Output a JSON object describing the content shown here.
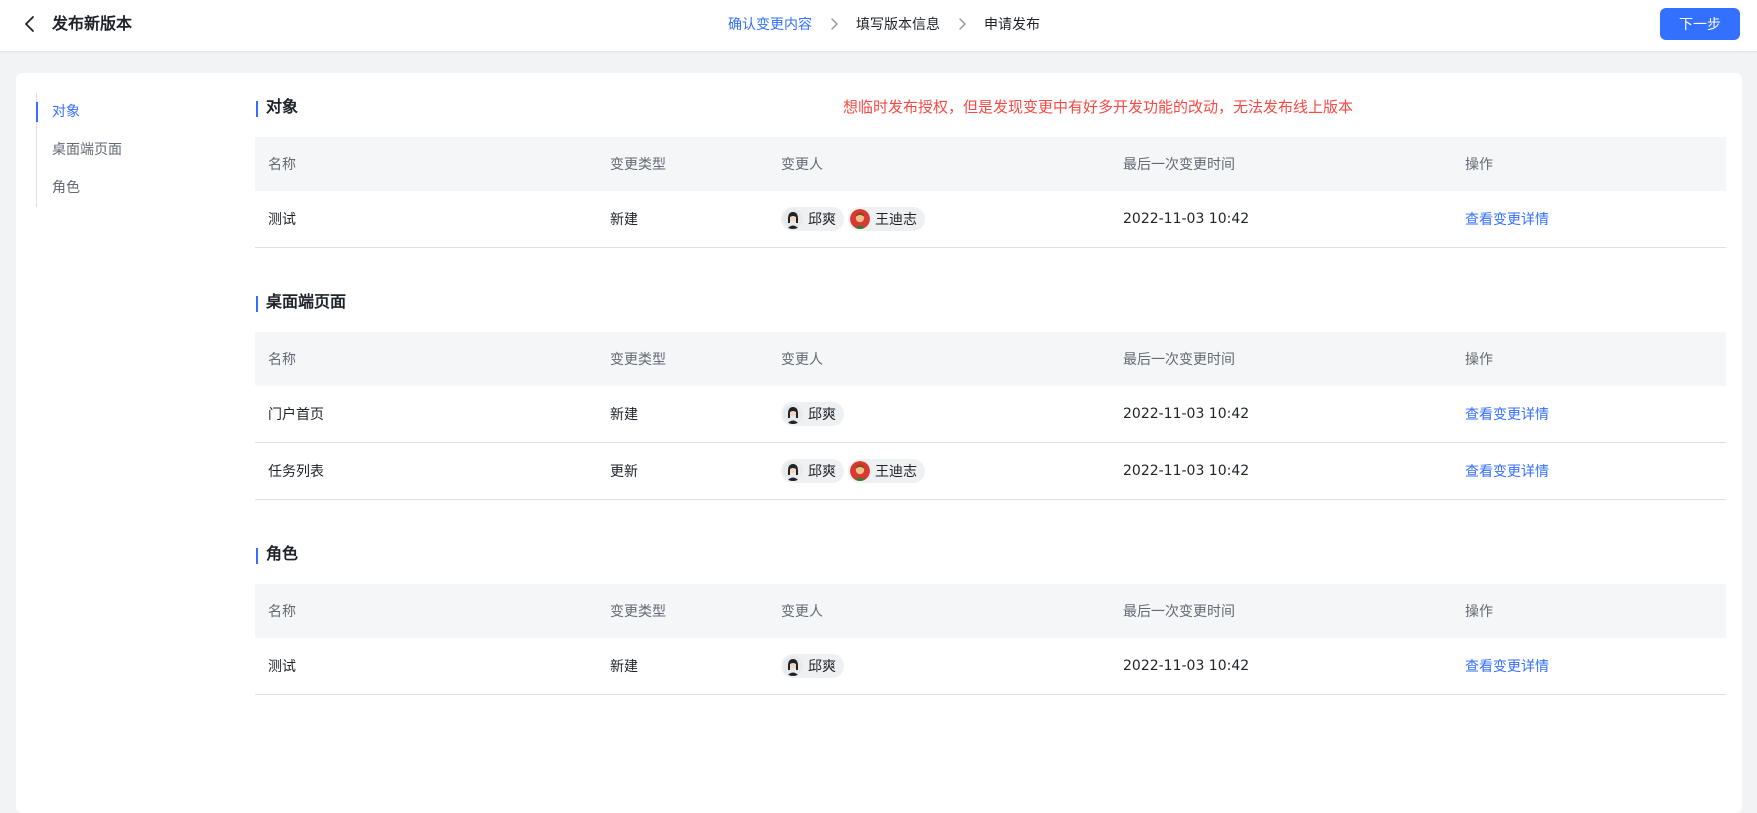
{
  "header": {
    "title": "发布新版本",
    "steps": [
      "确认变更内容",
      "填写版本信息",
      "申请发布"
    ],
    "next_label": "下一步"
  },
  "sidebar": {
    "items": [
      {
        "label": "对象"
      },
      {
        "label": "桌面端页面"
      },
      {
        "label": "角色"
      }
    ]
  },
  "annotation": "想临时发布授权，但是发现变更中有好多开发功能的改动，无法发布线上版本",
  "columns": [
    "名称",
    "变更类型",
    "变更人",
    "最后一次变更时间",
    "操作"
  ],
  "sections": [
    {
      "title": "对象",
      "rows": [
        {
          "name": "测试",
          "type": "新建",
          "people": [
            "邱爽",
            "王迪志"
          ],
          "time": "2022-11-03 10:42",
          "action": "查看变更详情"
        }
      ]
    },
    {
      "title": "桌面端页面",
      "rows": [
        {
          "name": "门户首页",
          "type": "新建",
          "people": [
            "邱爽"
          ],
          "time": "2022-11-03 10:42",
          "action": "查看变更详情"
        },
        {
          "name": "任务列表",
          "type": "更新",
          "people": [
            "邱爽",
            "王迪志"
          ],
          "time": "2022-11-03 10:42",
          "action": "查看变更详情"
        }
      ]
    },
    {
      "title": "角色",
      "rows": [
        {
          "name": "测试",
          "type": "新建",
          "people": [
            "邱爽"
          ],
          "time": "2022-11-03 10:42",
          "action": "查看变更详情"
        }
      ]
    }
  ]
}
